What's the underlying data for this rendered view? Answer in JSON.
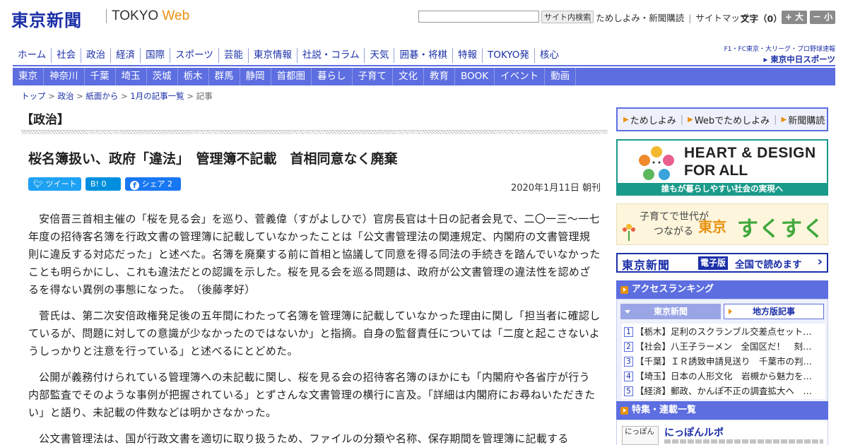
{
  "header": {
    "logo_jp": "東京新聞",
    "logo_en": "TOKYO",
    "logo_web": "Web",
    "search_button": "サイト内検索",
    "links": [
      "ためしよみ・新聞購読",
      "サイトマップ"
    ],
    "font_size_label": "文字（0）",
    "font_bigger": "+ 大",
    "font_smaller": "－ 小"
  },
  "nav_main": [
    "ホーム",
    "社会",
    "政治",
    "経済",
    "国際",
    "スポーツ",
    "芸能",
    "東京情報",
    "社説・コラム",
    "天気",
    "囲碁・将棋",
    "特報",
    "TOKYO発",
    "核心"
  ],
  "chunichi": {
    "sub": "F1・FC東京・大リーグ・プロ野球速報",
    "name": "▸ 東京中日スポーツ"
  },
  "nav_regional": [
    "東京",
    "神奈川",
    "千葉",
    "埼玉",
    "茨城",
    "栃木",
    "群馬",
    "静岡",
    "首都圏",
    "暮らし",
    "子育て",
    "文化",
    "教育",
    "BOOK",
    "イベント",
    "動画"
  ],
  "breadcrumb": [
    "トップ",
    "政治",
    "紙面から",
    "1月の記事一覧",
    "記事"
  ],
  "article": {
    "section": "【政治】",
    "headline": "桜名簿扱い、政府「違法」　管理簿不記載　首相同意なく廃棄",
    "tweet_label": "ツイート",
    "hatena_label": "B! 0",
    "share_label": "シェア 2",
    "dateline": "2020年1月11日 朝刊",
    "paragraphs": [
      "安倍晋三首相主催の「桜を見る会」を巡り、菅義偉（すがよしひで）官房長官は十日の記者会見で、二〇一三～一七年度の招待客名簿を行政文書の管理簿に記載していなかったことは「公文書管理法の関連規定、内閣府の文書管理規則に違反する対応だった」と述べた。名簿を廃棄する前に首相と協議して同意を得る同法の手続きを踏んでいなかったことも明らかにし、これも違法だとの認識を示した。桜を見る会を巡る問題は、政府が公文書管理の違法性を認めざるを得ない異例の事態になった。　（後藤孝好）",
      "菅氏は、第二次安倍政権発足後の五年間にわたって名簿を管理簿に記載していなかった理由に関し「担当者に確認しているが、問題に対しての意識が少なかったのではないか」と指摘。自身の監督責任については「二度と起こさないようしっかりと注意を行っている」と述べるにとどめた。",
      "公開が義務付けられている管理簿への未記載に関し、桜を見る会の招待客名簿のほかにも「内閣府や各省庁が行う内部監査でそのような事例が把握されている」とずさんな文書管理の横行に言及。「詳細は内閣府にお尋ねいただきたい」と語り、未記載の件数などは明かさなかった。",
      "公文書管理法は、国が行政文書を適切に取り扱うため、ファイルの分類や名称、保存期間を管理簿に記載する"
    ]
  },
  "sidebar": {
    "tameshi_links": [
      "ためしよみ",
      "Webでためしよみ",
      "新聞購読"
    ],
    "heart_line1": "HEART & DESIGN",
    "heart_line2": "FOR ALL",
    "heart_band": "誰もが暮らしやすい社会の実現へ",
    "sukusuku_line1": "子育てで世代が",
    "sukusuku_line2": "つながる",
    "sukusuku_tokyo": "東京",
    "sukusuku_main": "すくすく",
    "denshi_logo": "東京新聞",
    "denshi_badge": "電子版",
    "denshi_text": "全国で読めます",
    "ranking_title": "アクセスランキング",
    "ranking_tab1": "東京新聞",
    "ranking_tab2": "地方版記事",
    "ranking_items": [
      {
        "num": "1",
        "text": "【栃木】足利のスクランブル交差点セット…"
      },
      {
        "num": "2",
        "text": "【社会】八王子ラーメン　全国区だ！　刻…"
      },
      {
        "num": "3",
        "text": "【千葉】ＩＲ誘致申請見送り　千葉市の判…"
      },
      {
        "num": "4",
        "text": "【埼玉】日本の人形文化　岩槻から魅力を…"
      },
      {
        "num": "5",
        "text": "【経済】郵政、かんぽ不正の調査拡大へ　…"
      }
    ],
    "feature_title_head": "特集・連載一覧",
    "feature_thumb": "にっぽん",
    "feature_item": "にっぽんルポ"
  }
}
